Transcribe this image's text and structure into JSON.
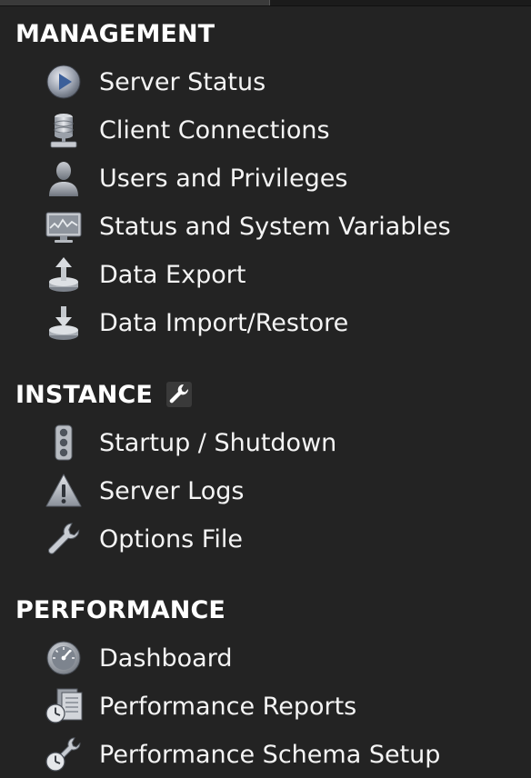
{
  "sections": [
    {
      "title": "MANAGEMENT",
      "items": [
        {
          "label": "Server Status",
          "icon": "play-circle-icon"
        },
        {
          "label": "Client Connections",
          "icon": "database-user-icon"
        },
        {
          "label": "Users and Privileges",
          "icon": "user-silhouette-icon"
        },
        {
          "label": "Status and System Variables",
          "icon": "monitor-graph-icon"
        },
        {
          "label": "Data Export",
          "icon": "export-upload-icon"
        },
        {
          "label": "Data Import/Restore",
          "icon": "import-download-icon"
        }
      ]
    },
    {
      "title": "INSTANCE",
      "title_icon": "wrench-icon",
      "items": [
        {
          "label": "Startup / Shutdown",
          "icon": "traffic-light-icon"
        },
        {
          "label": "Server Logs",
          "icon": "warning-triangle-icon"
        },
        {
          "label": "Options File",
          "icon": "wrench-icon"
        }
      ]
    },
    {
      "title": "PERFORMANCE",
      "items": [
        {
          "label": "Dashboard",
          "icon": "gauge-icon"
        },
        {
          "label": "Performance Reports",
          "icon": "reports-clock-icon"
        },
        {
          "label": "Performance Schema Setup",
          "icon": "schema-setup-icon"
        }
      ]
    }
  ]
}
